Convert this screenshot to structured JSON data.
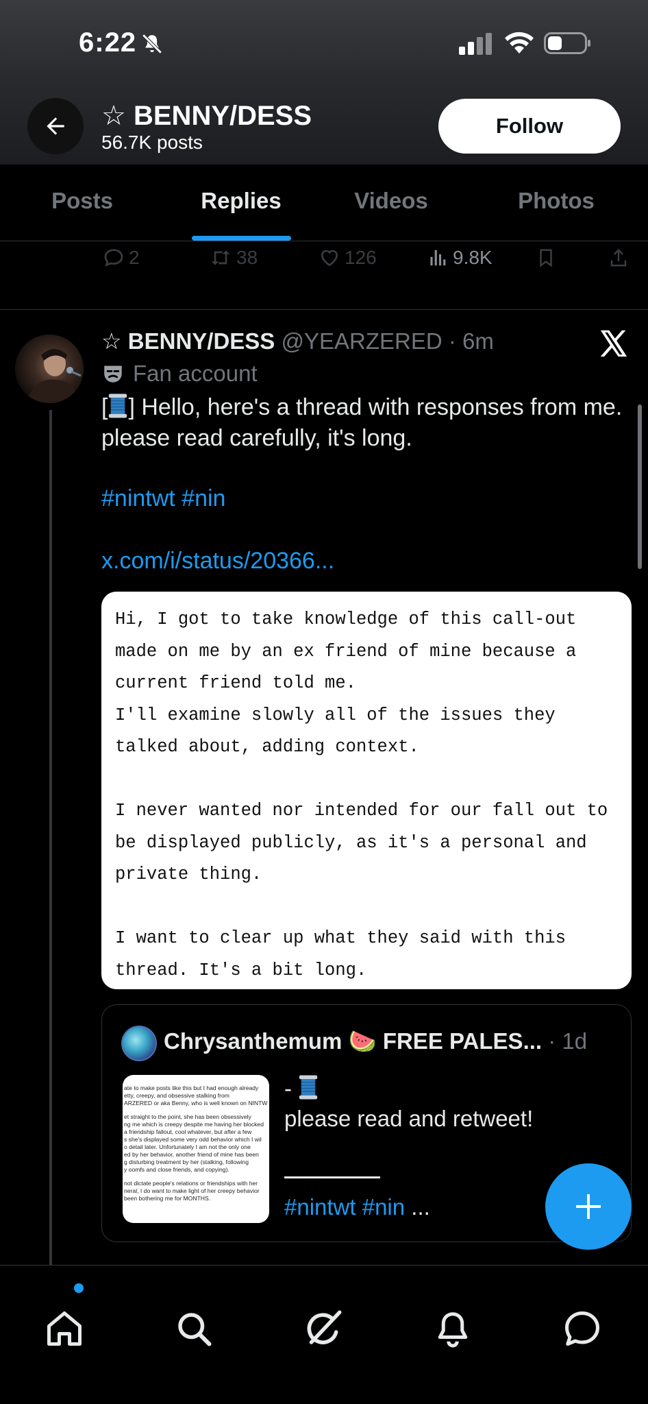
{
  "status_bar": {
    "time": "6:22"
  },
  "header": {
    "star": "☆",
    "name": "BENNY/DESS",
    "posts_count": "56.7K posts",
    "follow_label": "Follow"
  },
  "tabs": [
    {
      "label": "Posts",
      "active": false
    },
    {
      "label": "Replies",
      "active": true
    },
    {
      "label": "Videos",
      "active": false
    },
    {
      "label": "Photos",
      "active": false
    }
  ],
  "previous_tweet": {
    "replies": "2",
    "reposts": "38",
    "likes": "126",
    "views": "9.8K"
  },
  "tweet": {
    "star": "☆",
    "name": "BENNY/DESS",
    "handle": "@YEARZERED",
    "time": "· 6m",
    "label": "Fan account",
    "text_pre": "[",
    "text_post": "] Hello, here's a thread with responses from me. please read carefully, it's long.",
    "hashtags": "#nintwt #nin",
    "link": "x.com/i/status/20366...",
    "note": "Hi, I got to take knowledge of this call-out\nmade on me by an ex friend of mine because a\ncurrent friend told me.\nI'll examine slowly all of the issues they\ntalked about, adding context.\n\nI never wanted nor intended for our fall out to\nbe displayed publicly, as it's a personal and\nprivate thing.\n\nI want to clear up what they said with this\nthread. It's a bit long."
  },
  "quote": {
    "name": "Chrysanthemum 🍉 FREE PALES...",
    "time": "· 1d",
    "dash": "-",
    "text": "please read and retweet!",
    "tags": "#nintwt #nin",
    "ellipsis": " ...",
    "thumb_lines": [
      "ate to make posts like this but I had enough already",
      "etty, creepy, and obsessive stalking from",
      "ARZERED or aka Benny, who is well known on NINTW",
      "et straight to the point, she has been obsessively",
      "ng me which is creepy despite me having her blocked",
      "a friendship fallout, cool whatever, but after a few",
      "s she's displayed some very odd behavior which I wil",
      "o detail later. Unfortunately I am not the only one",
      "ed by her behavior, another friend of mine has been",
      "g disturbing treatment by her (stalking, following",
      "y oomfs and close friends, and copying).",
      "not dictate people's relations or friendships with her",
      "neral, I do want to make light of her creepy behavior",
      "been bothering me for MONTHS."
    ]
  },
  "colors": {
    "accent": "#1d9bf0",
    "background": "#000000",
    "text": "#e7e9ea",
    "muted": "#71767b"
  },
  "icons": [
    "back-arrow-icon",
    "bell-off-icon",
    "signal-icon",
    "wifi-icon",
    "battery-icon",
    "x-logo-icon",
    "theater-mask-icon",
    "spool-icon",
    "plus-icon",
    "home-icon",
    "search-icon",
    "grok-icon",
    "notifications-icon",
    "messages-icon"
  ]
}
